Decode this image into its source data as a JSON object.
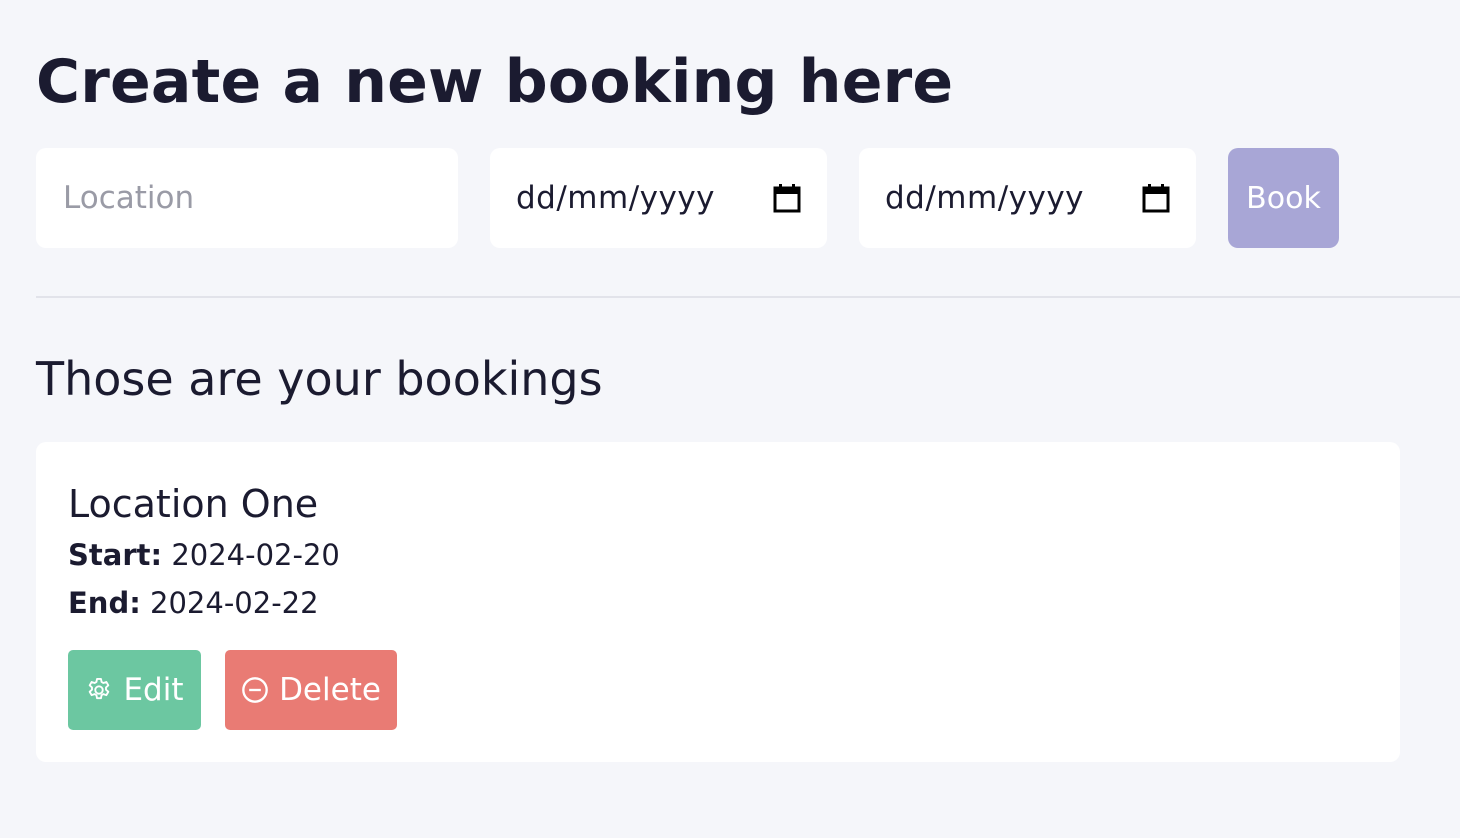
{
  "create": {
    "title": "Create a new booking here",
    "location_placeholder": "Location",
    "start_date_placeholder": "dd/mm/yyyy",
    "end_date_placeholder": "dd/mm/yyyy",
    "book_label": "Book",
    "book_button_color": "#a8a6d6"
  },
  "bookings": {
    "title": "Those are your bookings",
    "items": [
      {
        "location": "Location One",
        "start_label": "Start:",
        "start_value": "2024-02-20",
        "end_label": "End:",
        "end_value": "2024-02-22",
        "edit_label": "Edit",
        "edit_icon": "gear-icon",
        "delete_label": "Delete",
        "delete_icon": "minus-circle-icon"
      }
    ]
  },
  "colors": {
    "background": "#f5f6fa",
    "text": "#1b1b30",
    "edit": "#6cc7a1",
    "delete": "#e97b74"
  }
}
